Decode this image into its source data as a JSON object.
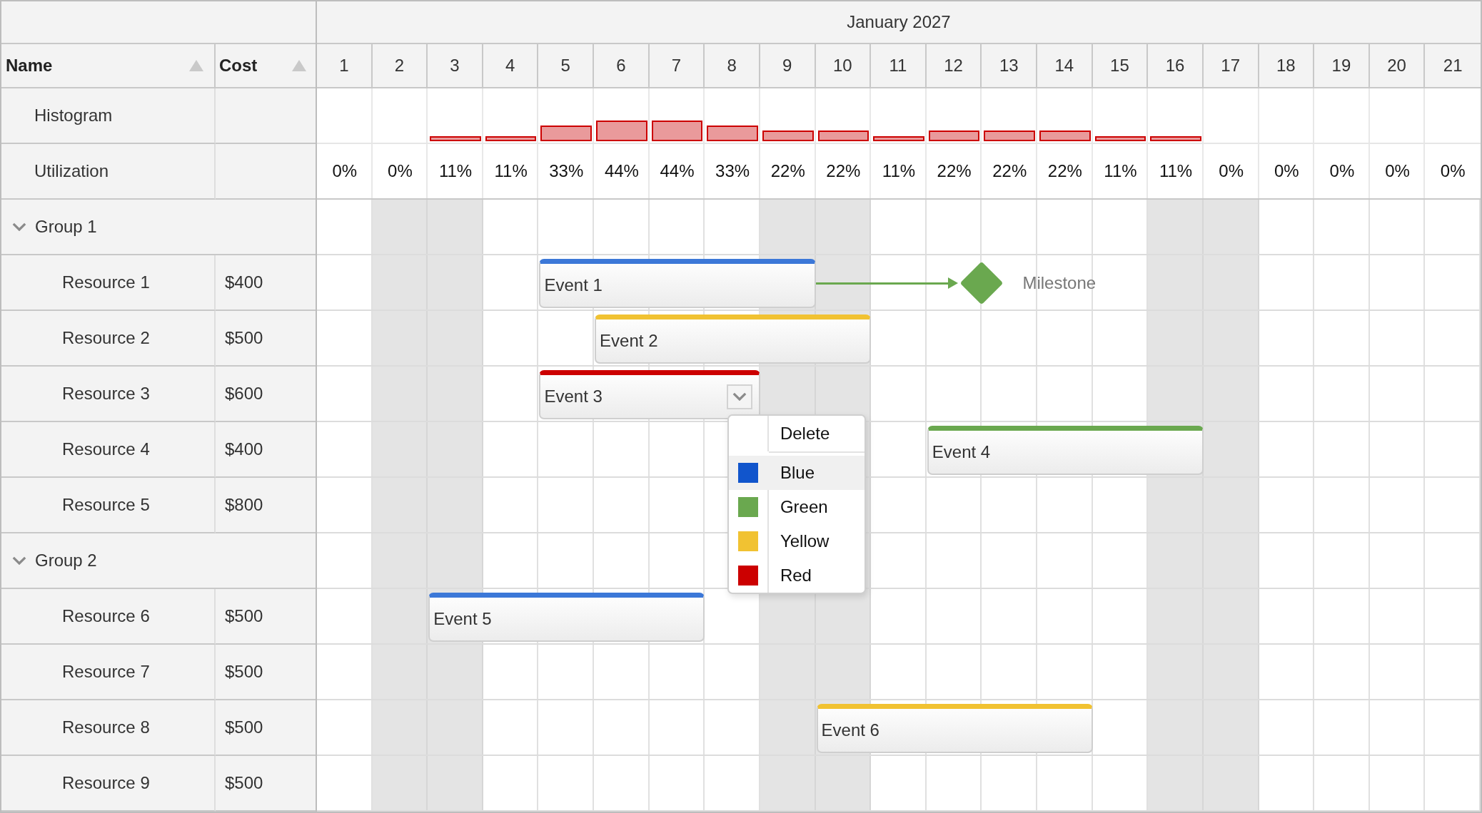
{
  "grid": {
    "columns": [
      {
        "label": "Name",
        "sorted": true
      },
      {
        "label": "Cost",
        "sorted": true
      }
    ]
  },
  "timeline": {
    "month": "January 2027",
    "days": [
      {
        "label": "1",
        "weekend": false
      },
      {
        "label": "2",
        "weekend": true
      },
      {
        "label": "3",
        "weekend": true
      },
      {
        "label": "4",
        "weekend": false
      },
      {
        "label": "5",
        "weekend": false
      },
      {
        "label": "6",
        "weekend": false
      },
      {
        "label": "7",
        "weekend": false
      },
      {
        "label": "8",
        "weekend": false
      },
      {
        "label": "9",
        "weekend": true
      },
      {
        "label": "10",
        "weekend": true
      },
      {
        "label": "11",
        "weekend": false
      },
      {
        "label": "12",
        "weekend": false
      },
      {
        "label": "13",
        "weekend": false
      },
      {
        "label": "14",
        "weekend": false
      },
      {
        "label": "15",
        "weekend": false
      },
      {
        "label": "16",
        "weekend": true
      },
      {
        "label": "17",
        "weekend": true
      },
      {
        "label": "18",
        "weekend": false
      },
      {
        "label": "19",
        "weekend": false
      },
      {
        "label": "20",
        "weekend": false
      },
      {
        "label": "21",
        "weekend": false
      }
    ]
  },
  "histogram": {
    "label": "Histogram"
  },
  "utilization": {
    "label": "Utilization",
    "values": [
      "0%",
      "0%",
      "11%",
      "11%",
      "33%",
      "44%",
      "44%",
      "33%",
      "22%",
      "22%",
      "11%",
      "22%",
      "22%",
      "22%",
      "11%",
      "11%",
      "0%",
      "0%",
      "0%",
      "0%",
      "0%"
    ]
  },
  "groups": [
    {
      "name": "Group 1",
      "expanded": true,
      "resources": [
        {
          "name": "Resource 1",
          "cost": "$400",
          "events": [
            {
              "label": "Event 1",
              "color": "#3c78d8",
              "menu_open": false
            }
          ],
          "milestones": [
            {
              "label": "Milestone",
              "linked": true
            }
          ]
        },
        {
          "name": "Resource 2",
          "cost": "$500",
          "events": [
            {
              "label": "Event 2",
              "color": "#f1c232",
              "menu_open": false
            }
          ]
        },
        {
          "name": "Resource 3",
          "cost": "$600",
          "events": [
            {
              "label": "Event 3",
              "color": "#cc0000",
              "menu_open": true,
              "menu": {
                "items": [
                  {
                    "kind": "command",
                    "label": "Delete",
                    "highlighted": false
                  },
                  {
                    "kind": "color",
                    "label": "Blue",
                    "color": "#1155cc",
                    "highlighted": true
                  },
                  {
                    "kind": "color",
                    "label": "Green",
                    "color": "#6aa84f",
                    "highlighted": false
                  },
                  {
                    "kind": "color",
                    "label": "Yellow",
                    "color": "#f1c232",
                    "highlighted": false
                  },
                  {
                    "kind": "color",
                    "label": "Red",
                    "color": "#cc0000",
                    "highlighted": false
                  }
                ]
              }
            }
          ]
        },
        {
          "name": "Resource 4",
          "cost": "$400",
          "events": [
            {
              "label": "Event 4",
              "color": "#6aa84f",
              "menu_open": false
            }
          ]
        },
        {
          "name": "Resource 5",
          "cost": "$800"
        }
      ]
    },
    {
      "name": "Group 2",
      "expanded": true,
      "resources": [
        {
          "name": "Resource 6",
          "cost": "$500",
          "events": [
            {
              "label": "Event 5",
              "color": "#3c78d8",
              "menu_open": false
            }
          ]
        },
        {
          "name": "Resource 7",
          "cost": "$500"
        },
        {
          "name": "Resource 8",
          "cost": "$500",
          "events": [
            {
              "label": "Event 6",
              "color": "#f1c232",
              "menu_open": false
            }
          ]
        },
        {
          "name": "Resource 9",
          "cost": "$500"
        }
      ]
    }
  ]
}
